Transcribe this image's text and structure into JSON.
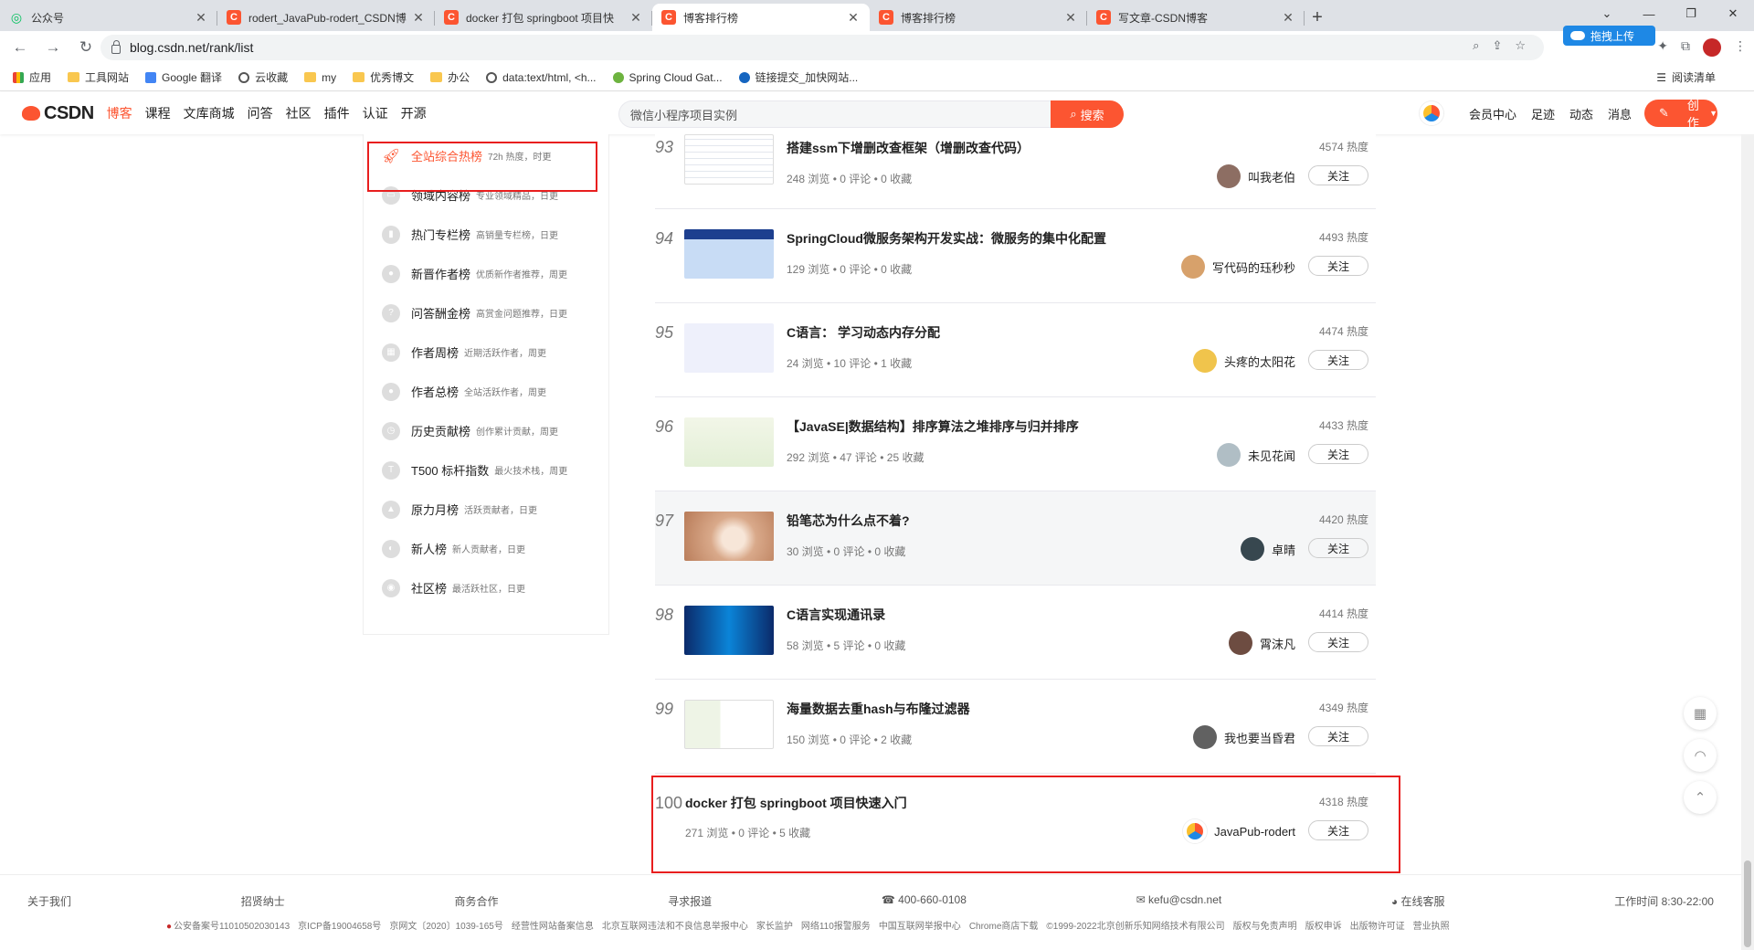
{
  "browser": {
    "tabs": [
      {
        "title": "公众号",
        "icon": "wechat-icon"
      },
      {
        "title": "rodert_JavaPub-rodert_CSDN博",
        "icon": "csdn-icon"
      },
      {
        "title": "docker 打包 springboot 项目快",
        "icon": "csdn-icon"
      },
      {
        "title": "博客排行榜",
        "icon": "csdn-icon",
        "active": true
      },
      {
        "title": "博客排行榜",
        "icon": "csdn-icon"
      },
      {
        "title": "写文章-CSDN博客",
        "icon": "csdn-icon"
      }
    ],
    "url": "blog.csdn.net/rank/list",
    "upload_pill": "拖拽上传",
    "bookmarks": [
      "应用",
      "工具网站",
      "Google 翻译",
      "云收藏",
      "my",
      "优秀博文",
      "办公",
      "data:text/html, <h...",
      "Spring Cloud Gat...",
      "链接提交_加快网站..."
    ],
    "reading_list": "阅读清单"
  },
  "csdn_header": {
    "logo": "CSDN",
    "nav": [
      "博客",
      "课程",
      "文库商城",
      "问答",
      "社区",
      "插件",
      "认证",
      "开源"
    ],
    "search_placeholder": "微信小程序项目实例",
    "search_button": "搜索",
    "right": [
      "会员中心",
      "足迹",
      "动态",
      "消息"
    ],
    "create": "创作"
  },
  "sidebar": [
    {
      "label": "全站综合热榜",
      "desc": "72h 热度，时更",
      "active": true
    },
    {
      "label": "领域内容榜",
      "desc": "专业领域精品，日更"
    },
    {
      "label": "热门专栏榜",
      "desc": "高销量专栏榜，日更"
    },
    {
      "label": "新晋作者榜",
      "desc": "优质新作者推荐，周更"
    },
    {
      "label": "问答酬金榜",
      "desc": "高赏金问题推荐，日更"
    },
    {
      "label": "作者周榜",
      "desc": "近期活跃作者，周更"
    },
    {
      "label": "作者总榜",
      "desc": "全站活跃作者，周更"
    },
    {
      "label": "历史贡献榜",
      "desc": "创作累计贡献，周更"
    },
    {
      "label": "T500 标杆指数",
      "desc": "最火技术栈，周更"
    },
    {
      "label": "原力月榜",
      "desc": "活跃贡献者，日更"
    },
    {
      "label": "新人榜",
      "desc": "新人贡献者，日更"
    },
    {
      "label": "社区榜",
      "desc": "最活跃社区，日更"
    }
  ],
  "ranking": [
    {
      "rank": "93",
      "title": "搭建ssm下增删改查框架（增删改查代码）",
      "heat": "4574 热度",
      "meta": "248 浏览 • 0 评论 • 0 收藏",
      "author": "叫我老伯",
      "follow": "关注"
    },
    {
      "rank": "94",
      "title": "SpringCloud微服务架构开发实战：微服务的集中化配置",
      "heat": "4493 热度",
      "meta": "129 浏览 • 0 评论 • 0 收藏",
      "author": "写代码的珏秒秒",
      "follow": "关注"
    },
    {
      "rank": "95",
      "title": "C语言： 学习动态内存分配",
      "heat": "4474 热度",
      "meta": "24 浏览 • 10 评论 • 1 收藏",
      "author": "头疼的太阳花",
      "follow": "关注"
    },
    {
      "rank": "96",
      "title": "【JavaSE|数据结构】排序算法之堆排序与归并排序",
      "heat": "4433 热度",
      "meta": "292 浏览 • 47 评论 • 25 收藏",
      "author": "未见花闻",
      "follow": "关注"
    },
    {
      "rank": "97",
      "title": "铅笔芯为什么点不着?",
      "heat": "4420 热度",
      "meta": "30 浏览 • 0 评论 • 0 收藏",
      "author": "卓晴",
      "follow": "关注"
    },
    {
      "rank": "98",
      "title": "C语言实现通讯录",
      "heat": "4414 热度",
      "meta": "58 浏览 • 5 评论 • 0 收藏",
      "author": "霄沫凡",
      "follow": "关注"
    },
    {
      "rank": "99",
      "title": "海量数据去重hash与布隆过滤器",
      "heat": "4349 热度",
      "meta": "150 浏览 • 0 评论 • 2 收藏",
      "author": "我也要当昏君",
      "follow": "关注"
    },
    {
      "rank": "100",
      "title": "docker 打包 springboot 项目快速入门",
      "heat": "4318 热度",
      "meta": "271 浏览 • 0 评论 • 5 收藏",
      "author": "JavaPub-rodert",
      "follow": "关注"
    }
  ],
  "footer": {
    "links": [
      "关于我们",
      "招贤纳士",
      "商务合作",
      "寻求报道",
      "400-660-0108",
      "kefu@csdn.net",
      "在线客服",
      "工作时间 8:30-22:00"
    ],
    "legal": [
      "公安备案号11010502030143",
      "京ICP备19004658号",
      "京网文〔2020〕1039-165号",
      "经营性网站备案信息",
      "北京互联网违法和不良信息举报中心",
      "家长监护",
      "网络110报警服务",
      "中国互联网举报中心",
      "Chrome商店下载",
      "©1999-2022北京创新乐知网络技术有限公司",
      "版权与免责声明",
      "版权申诉",
      "出版物许可证",
      "营业执照"
    ]
  }
}
